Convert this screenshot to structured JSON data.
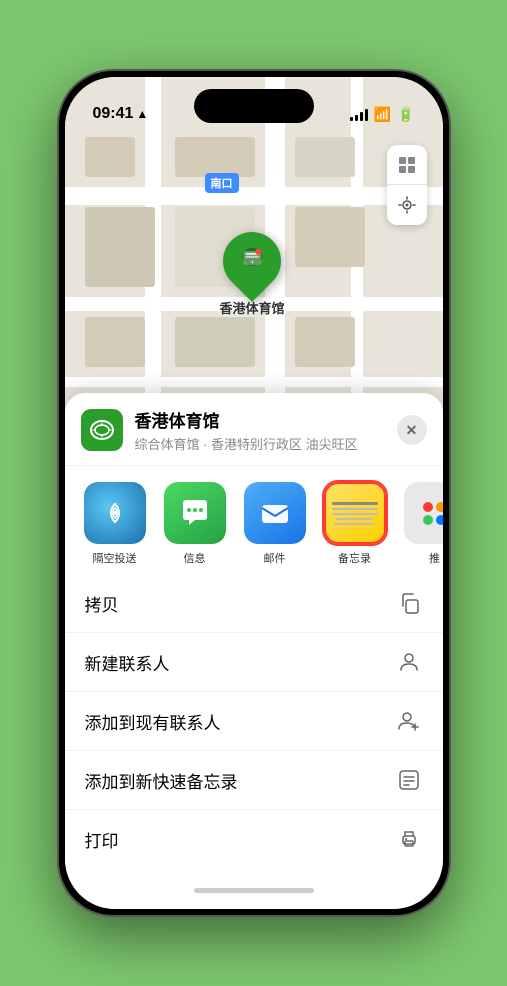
{
  "statusBar": {
    "time": "09:41",
    "locationArrow": "▲"
  },
  "map": {
    "label": "南口",
    "locationName": "香港体育馆"
  },
  "venueCard": {
    "name": "香港体育馆",
    "description": "综合体育馆 · 香港特别行政区 油尖旺区",
    "closeLabel": "✕"
  },
  "apps": [
    {
      "id": "airdrop",
      "label": "隔空投送",
      "icon": "📡"
    },
    {
      "id": "messages",
      "label": "信息",
      "icon": "💬"
    },
    {
      "id": "mail",
      "label": "邮件",
      "icon": "✉️"
    },
    {
      "id": "notes",
      "label": "备忘录",
      "selected": true
    }
  ],
  "moreColors": [
    "#ff3b30",
    "#ff9500",
    "#34c759",
    "#007aff",
    "#5856d6"
  ],
  "actions": [
    {
      "label": "拷贝",
      "icon": "copy"
    },
    {
      "label": "新建联系人",
      "icon": "person"
    },
    {
      "label": "添加到现有联系人",
      "icon": "person-add"
    },
    {
      "label": "添加到新快速备忘录",
      "icon": "note"
    },
    {
      "label": "打印",
      "icon": "print"
    }
  ]
}
